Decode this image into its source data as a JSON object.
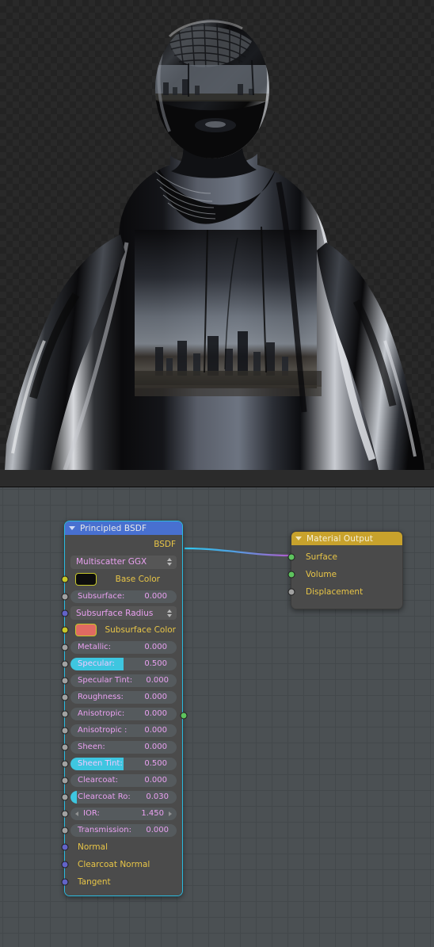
{
  "app": {
    "name": "Blender Shader Editor",
    "render_preview_label": "rendered-material-preview"
  },
  "render": {
    "subject": "glossy-black-mannequin-figure",
    "background": "alpha-checkerboard",
    "checker_light": "#292929",
    "checker_dark": "#232323",
    "notes": "reflective black body reflecting an outdoor HDRI city skyline"
  },
  "node_editor": {
    "background": "#4b5053",
    "grid_line": "#43484b",
    "grid_line_major": "#3c4144"
  },
  "nodes": {
    "principled": {
      "title": "Principled BSDF",
      "header_color": "#4870d0",
      "outline_color": "#2abbe0",
      "outputs": [
        {
          "name": "BSDF",
          "socket": "green"
        }
      ],
      "distribution": {
        "label": "Multiscatter GGX",
        "type": "dropdown"
      },
      "sockets": [
        {
          "name": "Base Color",
          "type": "color",
          "socket": "yellow",
          "value": "#0d0d0d"
        },
        {
          "name": "Subsurface:",
          "type": "slider",
          "socket": "grey",
          "value": "0.000",
          "fill": 0
        },
        {
          "name": "Subsurface Radius",
          "type": "menu",
          "socket": "purple",
          "value": ""
        },
        {
          "name": "Subsurface Color",
          "type": "color",
          "socket": "yellow",
          "value": "#e06a62"
        },
        {
          "name": "Metallic:",
          "type": "slider",
          "socket": "grey",
          "value": "0.000",
          "fill": 0
        },
        {
          "name": "Specular:",
          "type": "slider",
          "socket": "grey",
          "value": "0.500",
          "fill": 50
        },
        {
          "name": "Specular Tint:",
          "type": "slider",
          "socket": "grey",
          "value": "0.000",
          "fill": 0
        },
        {
          "name": "Roughness:",
          "type": "slider",
          "socket": "grey",
          "value": "0.000",
          "fill": 0
        },
        {
          "name": "Anisotropic:",
          "type": "slider",
          "socket": "grey",
          "value": "0.000",
          "fill": 0
        },
        {
          "name": "Anisotropic :",
          "type": "slider",
          "socket": "grey",
          "value": "0.000",
          "fill": 0
        },
        {
          "name": "Sheen:",
          "type": "slider",
          "socket": "grey",
          "value": "0.000",
          "fill": 0
        },
        {
          "name": "Sheen Tint:",
          "type": "slider",
          "socket": "grey",
          "value": "0.500",
          "fill": 50
        },
        {
          "name": "Clearcoat:",
          "type": "slider",
          "socket": "grey",
          "value": "0.000",
          "fill": 0
        },
        {
          "name": "Clearcoat Ro:",
          "type": "slider",
          "socket": "grey",
          "value": "0.030",
          "fill": 3
        },
        {
          "name": "IOR:",
          "type": "number",
          "socket": "grey",
          "value": "1.450"
        },
        {
          "name": "Transmission:",
          "type": "slider",
          "socket": "grey",
          "value": "0.000",
          "fill": 0
        },
        {
          "name": "Normal",
          "type": "plain",
          "socket": "purple",
          "value": ""
        },
        {
          "name": "Clearcoat Normal",
          "type": "plain",
          "socket": "purple",
          "value": ""
        },
        {
          "name": "Tangent",
          "type": "plain",
          "socket": "purple",
          "value": ""
        }
      ]
    },
    "material_output": {
      "title": "Material Output",
      "header_color": "#c8a22c",
      "inputs": [
        {
          "name": "Surface",
          "socket": "green"
        },
        {
          "name": "Volume",
          "socket": "green"
        },
        {
          "name": "Displacement",
          "socket": "grey"
        }
      ]
    }
  },
  "link": {
    "from": "Principled BSDF.BSDF",
    "to": "Material Output.Surface",
    "color_start": "#2fc8f0",
    "color_end": "#b05ccc"
  }
}
